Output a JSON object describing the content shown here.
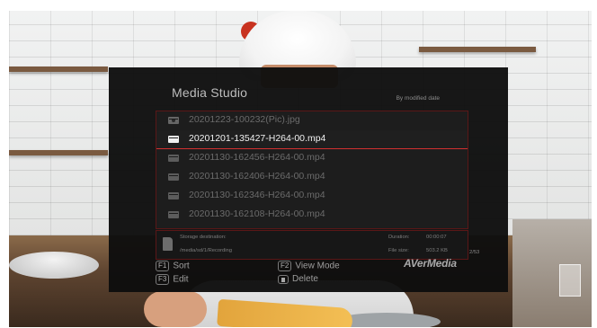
{
  "panel": {
    "title": "Media Studio",
    "sort_mode": "By modified date",
    "files": [
      {
        "name": "20201223-100232(Pic).jpg",
        "type": "photo",
        "selected": false
      },
      {
        "name": "20201201-135427-H264-00.mp4",
        "type": "video",
        "selected": true
      },
      {
        "name": "20201130-162456-H264-00.mp4",
        "type": "video",
        "selected": false
      },
      {
        "name": "20201130-162406-H264-00.mp4",
        "type": "video",
        "selected": false
      },
      {
        "name": "20201130-162346-H264-00.mp4",
        "type": "video",
        "selected": false
      },
      {
        "name": "20201130-162108-H264-00.mp4",
        "type": "video",
        "selected": false
      }
    ],
    "info": {
      "storage_label": "Storage destination:",
      "storage_path": "/media/sd/1/Recording",
      "duration_label": "Duration:",
      "duration_value": "00:00:07",
      "filesize_label": "File size:",
      "filesize_value": "503.2 KB"
    },
    "page_count": "2/53",
    "brand": "AVerMedia",
    "keys": {
      "sort": {
        "key": "F1",
        "label": "Sort"
      },
      "edit": {
        "key": "F3",
        "label": "Edit"
      },
      "view_mode": {
        "key": "F2",
        "label": "View Mode"
      },
      "delete": {
        "icon": "trash-icon",
        "label": "Delete"
      }
    }
  }
}
